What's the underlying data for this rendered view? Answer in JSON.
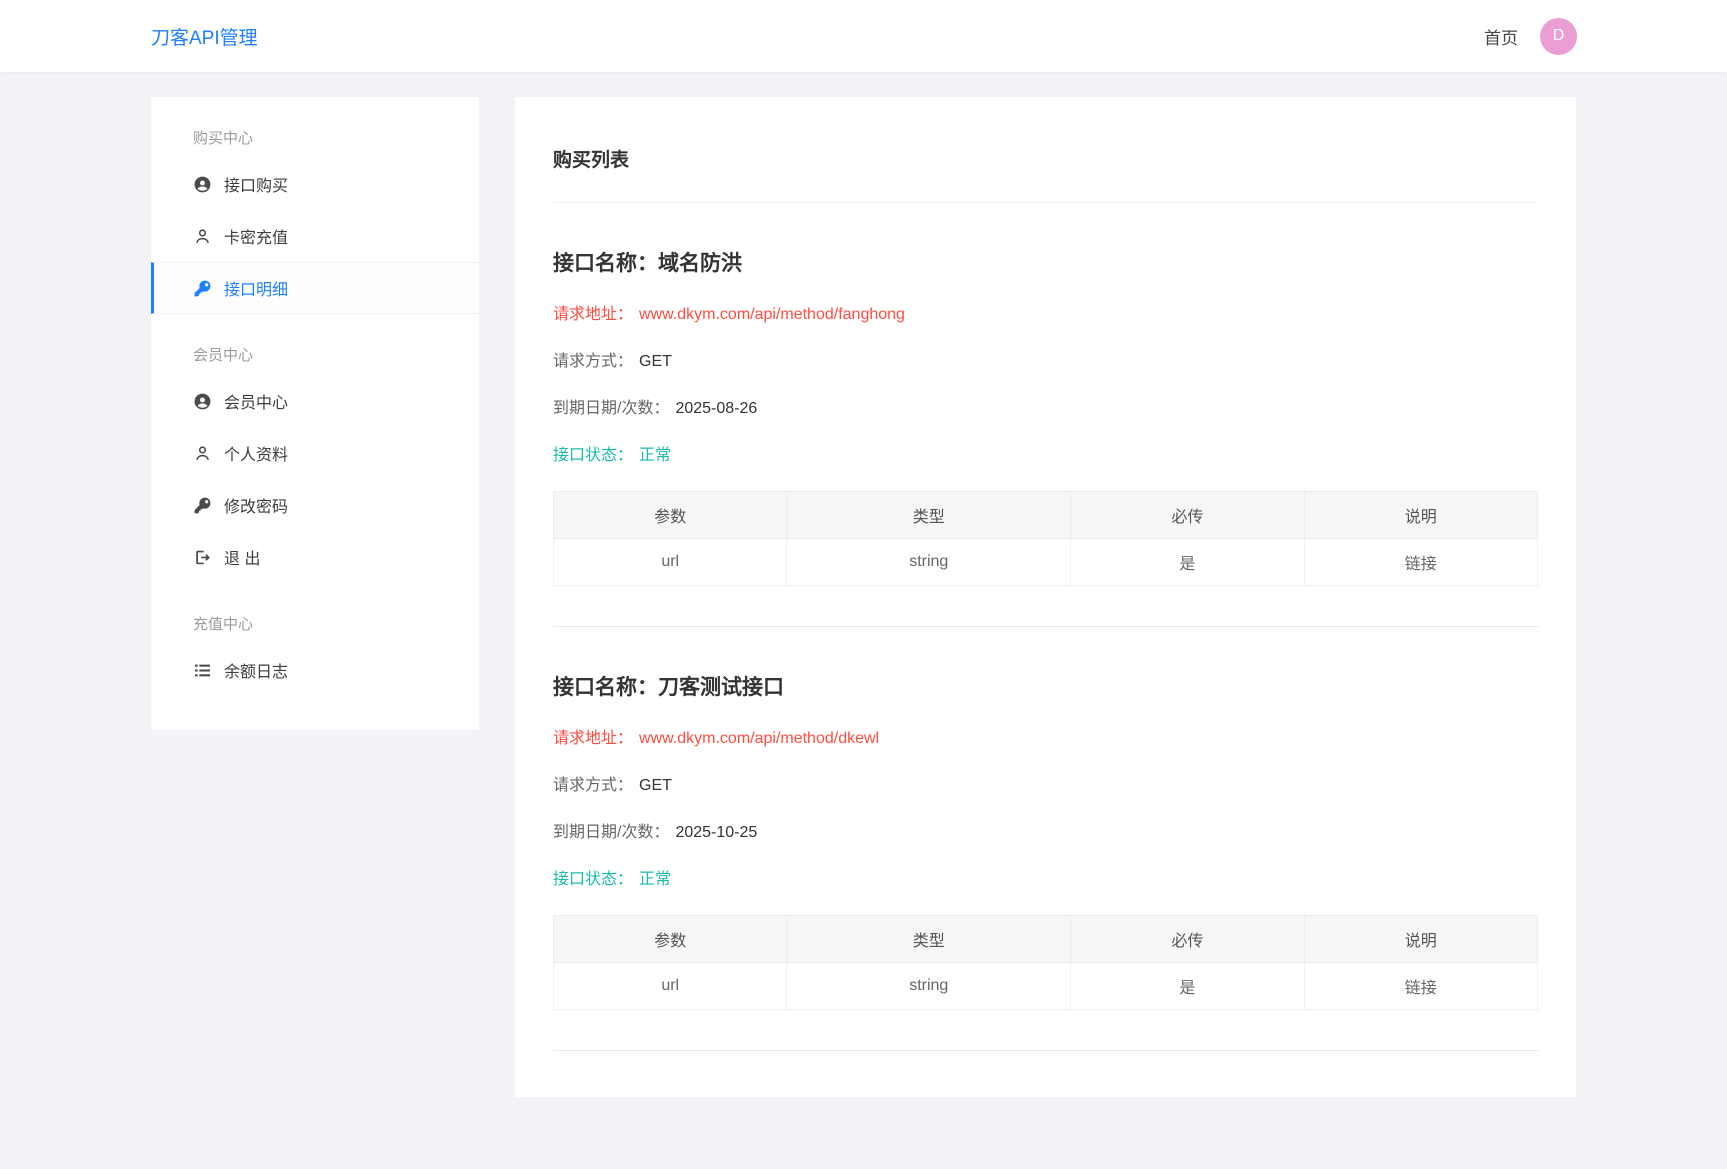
{
  "header": {
    "brand": "刀客API管理",
    "nav_home": "首页",
    "avatar_letter": "D"
  },
  "colors": {
    "accent_blue": "#1E80FF",
    "url_red": "#ff4c41",
    "status_green": "#19bcab",
    "avatar_pink": "#eb9ed3",
    "page_background": "#f1f3f6"
  },
  "sidebar": {
    "sections": [
      {
        "title": "购买中心",
        "items": [
          {
            "id": "api-purchase",
            "label": "接口购买",
            "icon": "user-circle-icon",
            "active": false
          },
          {
            "id": "card-recharge",
            "label": "卡密充值",
            "icon": "user-outline-icon",
            "active": false
          },
          {
            "id": "api-detail",
            "label": "接口明细",
            "icon": "key-icon",
            "active": true
          }
        ]
      },
      {
        "title": "会员中心",
        "items": [
          {
            "id": "member-center",
            "label": "会员中心",
            "icon": "user-circle-icon",
            "active": false
          },
          {
            "id": "profile",
            "label": "个人资料",
            "icon": "user-outline-icon",
            "active": false
          },
          {
            "id": "change-password",
            "label": "修改密码",
            "icon": "key-icon",
            "active": false
          },
          {
            "id": "logout",
            "label": "退 出",
            "icon": "sign-out-icon",
            "active": false
          }
        ]
      },
      {
        "title": "充值中心",
        "items": [
          {
            "id": "balance-log",
            "label": "余额日志",
            "icon": "list-icon",
            "active": false
          }
        ]
      }
    ]
  },
  "main": {
    "title": "购买列表",
    "labels": {
      "name": "接口名称：",
      "url": "请求地址：",
      "method": "请求方式：",
      "expire": "到期日期/次数：",
      "status": "接口状态："
    },
    "apis": [
      {
        "name": "域名防洪",
        "url": "www.dkym.com/api/method/fanghong",
        "method": "GET",
        "expire": "2025-08-26",
        "status": "正常",
        "table": {
          "headers": [
            "参数",
            "类型",
            "必传",
            "说明"
          ],
          "rows": [
            [
              "url",
              "string",
              "是",
              "链接"
            ]
          ]
        }
      },
      {
        "name": "刀客测试接口",
        "url": "www.dkym.com/api/method/dkewl",
        "method": "GET",
        "expire": "2025-10-25",
        "status": "正常",
        "table": {
          "headers": [
            "参数",
            "类型",
            "必传",
            "说明"
          ],
          "rows": [
            [
              "url",
              "string",
              "是",
              "链接"
            ]
          ]
        }
      }
    ]
  }
}
